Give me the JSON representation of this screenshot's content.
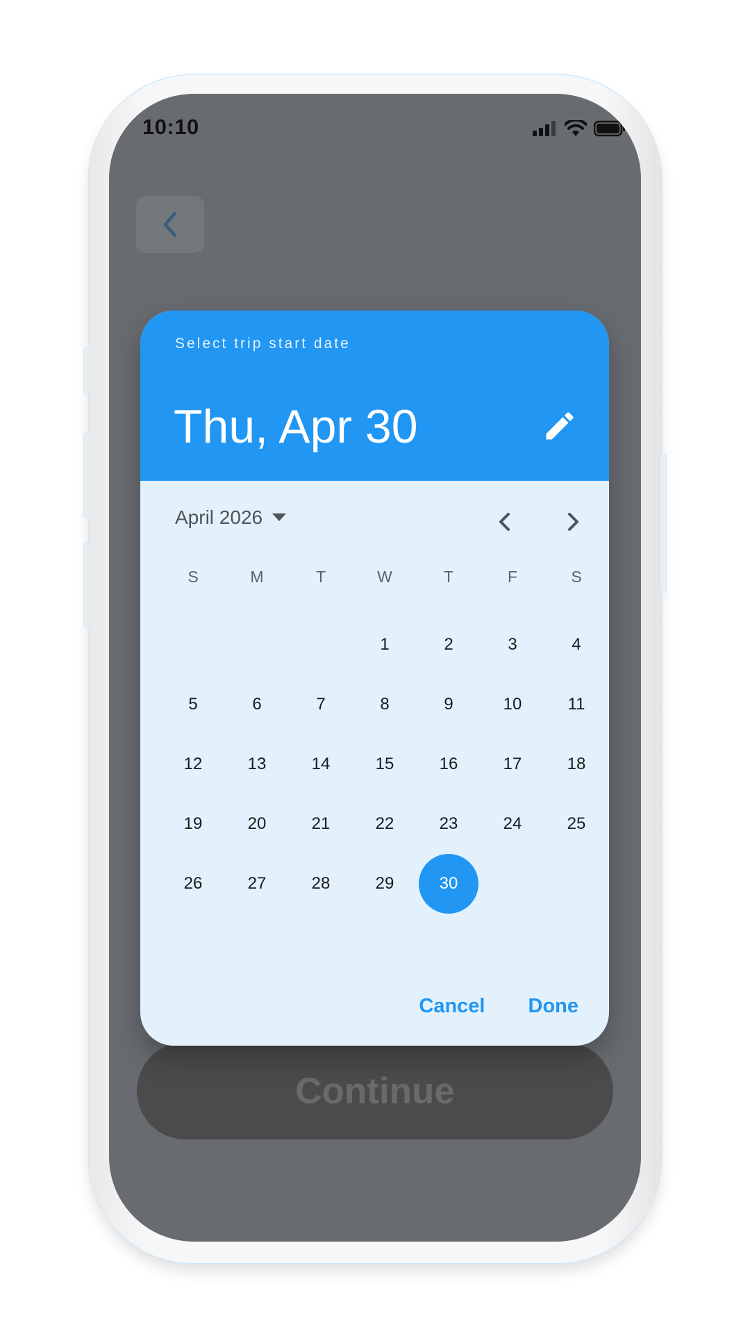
{
  "status_bar": {
    "time": "10:10"
  },
  "background": {
    "continue_label": "Continue"
  },
  "dialog": {
    "help_text": "Select trip start date",
    "selected_date": "Thu, Apr 30",
    "month_label": "April 2026",
    "weekdays": [
      "S",
      "M",
      "T",
      "W",
      "T",
      "F",
      "S"
    ],
    "days": [
      "",
      "",
      "",
      "1",
      "2",
      "3",
      "4",
      "5",
      "6",
      "7",
      "8",
      "9",
      "10",
      "11",
      "12",
      "13",
      "14",
      "15",
      "16",
      "17",
      "18",
      "19",
      "20",
      "21",
      "22",
      "23",
      "24",
      "25",
      "26",
      "27",
      "28",
      "29",
      "30",
      "",
      ""
    ],
    "selected_day": "30",
    "cancel_label": "Cancel",
    "done_label": "Done"
  },
  "colors": {
    "accent": "#2196f3",
    "dialog_body": "#e2f1fc",
    "scrim": "#686c71"
  },
  "icons": [
    "back-chevron-icon",
    "edit-pencil-icon",
    "dropdown-arrow-icon",
    "chevron-left-icon",
    "chevron-right-icon",
    "signal-icon",
    "wifi-icon",
    "battery-icon"
  ]
}
